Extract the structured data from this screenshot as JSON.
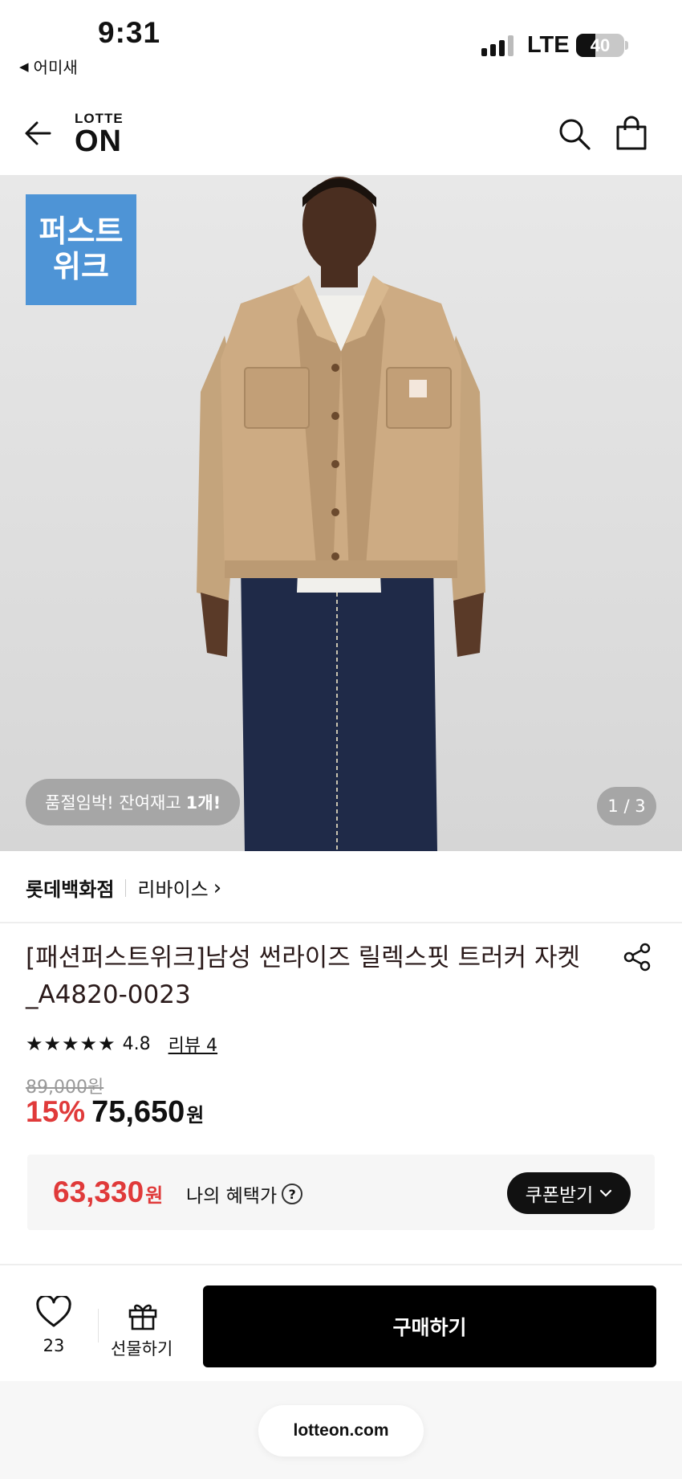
{
  "status_bar": {
    "time": "9:31",
    "back_app": "어미새",
    "network": "LTE",
    "battery": "40",
    "battery_level": 0.4
  },
  "header": {
    "logo_top": "LOTTE",
    "logo_main": "ON",
    "icons": [
      "back-arrow-icon",
      "search-icon",
      "shopping-bag-icon"
    ]
  },
  "hero": {
    "badge_line1": "퍼스트",
    "badge_line2": "위크",
    "stock_text": "품절임박! 잔여재고",
    "stock_count": "1개!",
    "page_indicator": "1 / 3"
  },
  "store": {
    "department": "롯데백화점",
    "brand": "리바이스",
    "brand_chevron": "›"
  },
  "product": {
    "title": "[패션퍼스트위크]남성 썬라이즈 릴렉스핏 트러커 자켓_A4820-0023",
    "stars": "★★★★★",
    "rating": "4.8",
    "review_link": "리뷰 4",
    "original_price": "89,000원",
    "discount": "15%",
    "sale_price": "75,650",
    "currency": "원"
  },
  "benefit": {
    "price": "63,330",
    "currency": "원",
    "label": "나의 혜택가",
    "help": "?",
    "coupon_button": "쿠폰받기"
  },
  "bottom_bar": {
    "wish_count": "23",
    "gift_label": "선물하기",
    "buy_button": "구매하기"
  },
  "browser": {
    "domain": "lotteon.com"
  },
  "colors": {
    "accent_red": "#e03a3a",
    "badge_blue": "#4e94d6",
    "button_black": "#000000"
  }
}
